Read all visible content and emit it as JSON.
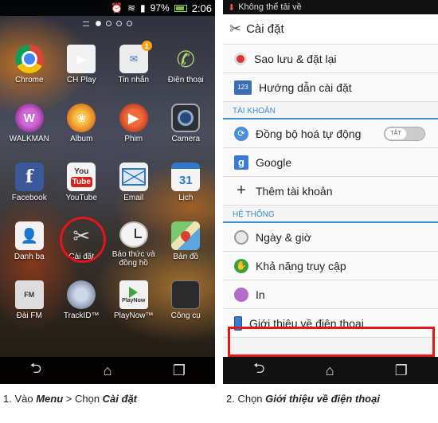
{
  "left": {
    "status": {
      "battery": "97%",
      "time": "2:06"
    },
    "apps": [
      {
        "label": "Chrome",
        "icon": "chrome-icon",
        "glyph": ""
      },
      {
        "label": "CH Play",
        "icon": "play-store-icon",
        "glyph": "▶"
      },
      {
        "label": "Tin nhắn",
        "icon": "messages-icon",
        "glyph": "✉",
        "badge": "1"
      },
      {
        "label": "Điện thoại",
        "icon": "phone-icon",
        "glyph": "✆"
      },
      {
        "label": "WALKMAN",
        "icon": "walkman-icon",
        "glyph": "W"
      },
      {
        "label": "Album",
        "icon": "album-icon",
        "glyph": "❀"
      },
      {
        "label": "Phim",
        "icon": "movies-icon",
        "glyph": "▶"
      },
      {
        "label": "Camera",
        "icon": "camera-icon",
        "glyph": ""
      },
      {
        "label": "Facebook",
        "icon": "facebook-icon",
        "glyph": "f"
      },
      {
        "label": "YouTube",
        "icon": "youtube-icon",
        "glyph": "You",
        "glyph2": "Tube"
      },
      {
        "label": "Email",
        "icon": "email-icon",
        "glyph": ""
      },
      {
        "label": "Lịch",
        "icon": "calendar-icon",
        "glyph": "31"
      },
      {
        "label": "Danh bạ",
        "icon": "contacts-icon",
        "glyph": "👤"
      },
      {
        "label": "Cài đặt",
        "icon": "settings-icon",
        "glyph": "✂"
      },
      {
        "label": "Báo thức và đồng hồ",
        "icon": "alarm-clock-icon",
        "glyph": ""
      },
      {
        "label": "Bản đồ",
        "icon": "maps-icon",
        "glyph": ""
      },
      {
        "label": "Đài FM",
        "icon": "fm-radio-icon",
        "glyph": "FM"
      },
      {
        "label": "TrackID™",
        "icon": "trackid-icon",
        "glyph": ""
      },
      {
        "label": "PlayNow™",
        "icon": "playnow-icon",
        "glyph": "PlayNow"
      },
      {
        "label": "Công cụ",
        "icon": "tools-icon",
        "glyph": ""
      }
    ]
  },
  "right": {
    "notification": "Không thể tải về",
    "title": "Cài đặt",
    "rows_top": [
      {
        "label": "Sao lưu & đặt lại",
        "icon": "backup-icon",
        "glyph": ""
      },
      {
        "label": "Hướng dẫn cài đặt",
        "icon": "setup-guide-icon",
        "glyph": "123"
      }
    ],
    "section_accounts": "TÀI KHOẢN",
    "rows_accounts": [
      {
        "label": "Đồng bộ hoá tự động",
        "icon": "sync-icon",
        "glyph": "⟳",
        "toggle": "TẮT"
      },
      {
        "label": "Google",
        "icon": "google-icon",
        "glyph": "g"
      },
      {
        "label": "Thêm tài khoản",
        "icon": "add-icon",
        "glyph": "+"
      }
    ],
    "section_system": "HỆ THỐNG",
    "rows_system": [
      {
        "label": "Ngày & giờ",
        "icon": "clock-icon",
        "glyph": ""
      },
      {
        "label": "Khả năng truy cập",
        "icon": "accessibility-icon",
        "glyph": "✋"
      },
      {
        "label": "In",
        "icon": "print-icon",
        "glyph": ""
      },
      {
        "label": "Giới thiệu về điện thoại",
        "icon": "device-info-icon",
        "glyph": ""
      }
    ]
  },
  "captions": {
    "left_prefix": "1. Vào ",
    "left_menu": "Menu",
    "left_mid": " > Chọn ",
    "left_target": "Cài đặt",
    "right_prefix": "2. Chọn ",
    "right_target": "Giới thiệu về điện thoại"
  },
  "colors": {
    "highlight": "#e4151b",
    "section_accent": "#3a8fd4"
  }
}
